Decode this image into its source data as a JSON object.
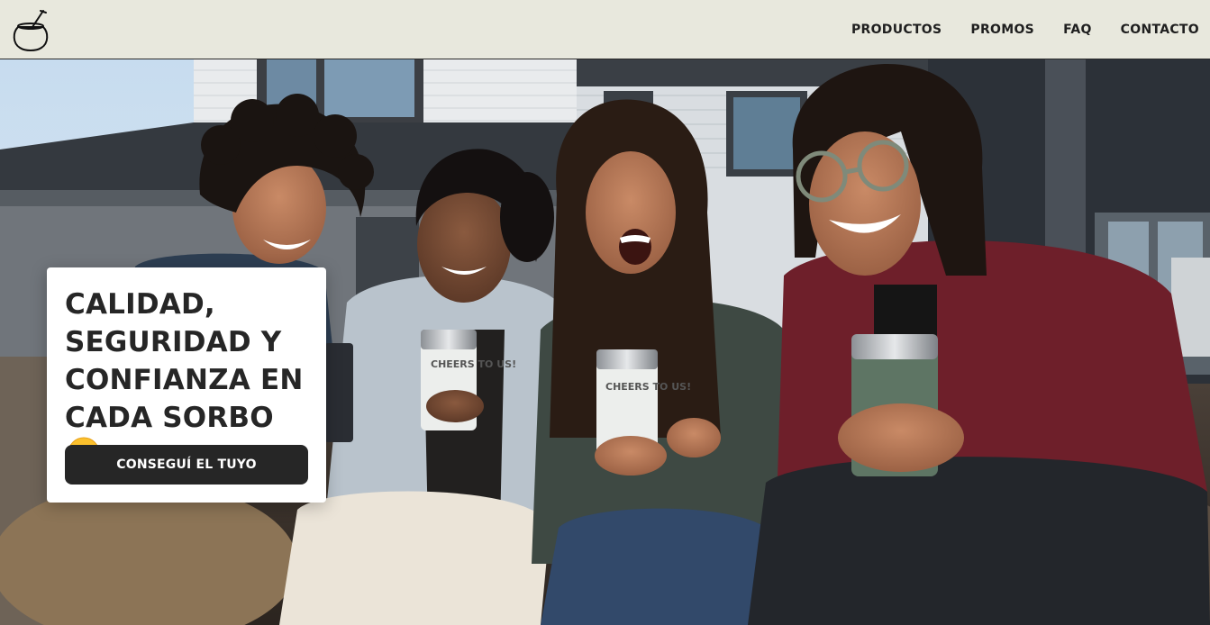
{
  "header": {
    "logo_icon": "mate-gourd-icon",
    "nav": [
      {
        "label": "PRODUCTOS"
      },
      {
        "label": "PROMOS"
      },
      {
        "label": "FAQ"
      },
      {
        "label": "CONTACTO"
      }
    ]
  },
  "hero": {
    "image_text": "CHEERS TO US!",
    "title_lines": [
      "CALIDAD,",
      "SEGURIDAD Y",
      "CONFIANZA EN",
      "CADA SORBO"
    ],
    "title_emoji": "face-savoring-food-emoji",
    "cta_label": "CONSEGUÍ EL TUYO"
  },
  "colors": {
    "header_bg": "#e8e8dd",
    "text_dark": "#262626",
    "button_bg": "#262626",
    "button_text": "#ffffff",
    "card_bg": "#ffffff"
  }
}
